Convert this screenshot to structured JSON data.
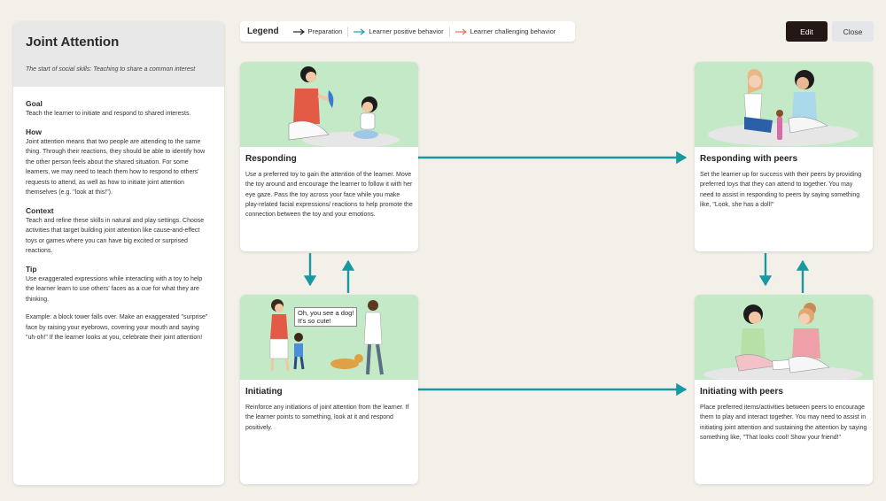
{
  "sidebar": {
    "title": "Joint Attention",
    "subtitle": "The start of social skills: Teaching to share a common interest",
    "goal_heading": "Goal",
    "goal_text": "Teach the learner to initiate and respond to shared interests.",
    "how_heading": "How",
    "how_text": "Joint attention means that two people are attending to the same thing. Through their reactions, they should be able to identify how the other person feels about the shared situation. For some learners, we may need to teach them how to respond to others' requests to attend, as well as how to initiate joint attention themselves (e.g. \"look at this!\").",
    "context_heading": "Context",
    "context_text": "Teach and refine these skills in natural and play settings. Choose activities that target building joint attention like cause-and-effect toys or games where you can have big excited or surprised reactions.",
    "tip_heading": "Tip",
    "tip_text": "Use exaggerated expressions while interacting with a toy to help the learner learn to use others' faces as a cue for what they are thinking.",
    "example_text": "Example: a block tower falls over. Make an exaggerated \"surprise\" face by raising your eyebrows, covering your mouth and saying \"uh-oh!\" If the learner looks at you, celebrate their joint attention!"
  },
  "legend": {
    "title": "Legend",
    "items": [
      {
        "label": "Preparation",
        "color": "#222222"
      },
      {
        "label": "Learner positive behavior",
        "color": "#1aa3ad"
      },
      {
        "label": "Learner challenging behavior",
        "color": "#e8745a"
      }
    ]
  },
  "buttons": {
    "edit": "Edit",
    "close": "Close"
  },
  "colors": {
    "teal": "#17999f",
    "card_image_bg": "#c3e9c6",
    "edit_bg": "#231815"
  },
  "cards": [
    {
      "title": "Responding",
      "text": "Use a preferred toy to gain the attention of the learner. Move the toy around and encourage the learner to follow it with her eye gaze. Pass the toy across your face while you make play-related facial expressions/ reactions to help promote the connection between the toy and your emotions."
    },
    {
      "title": "Responding with peers",
      "text": "Set the learner up for success with their peers by providing preferred toys that they can attend to together. You may need to assist in responding to peers by saying something like, \"Look, she has a doll!\""
    },
    {
      "title": "Initiating",
      "text": "Reinforce any initiations of joint attention from the learner. If the learner points to something, look at it and respond positively.",
      "speech_bubble": [
        "Oh, you see a dog!",
        "It's so cute!"
      ]
    },
    {
      "title": "Initiating with peers",
      "text": "Place preferred items/activities between peers to encourage them to play and interact together. You may need to assist in initiating joint attention and sustaining the attention by saying something like, \"That looks cool! Show your friend!\""
    }
  ]
}
